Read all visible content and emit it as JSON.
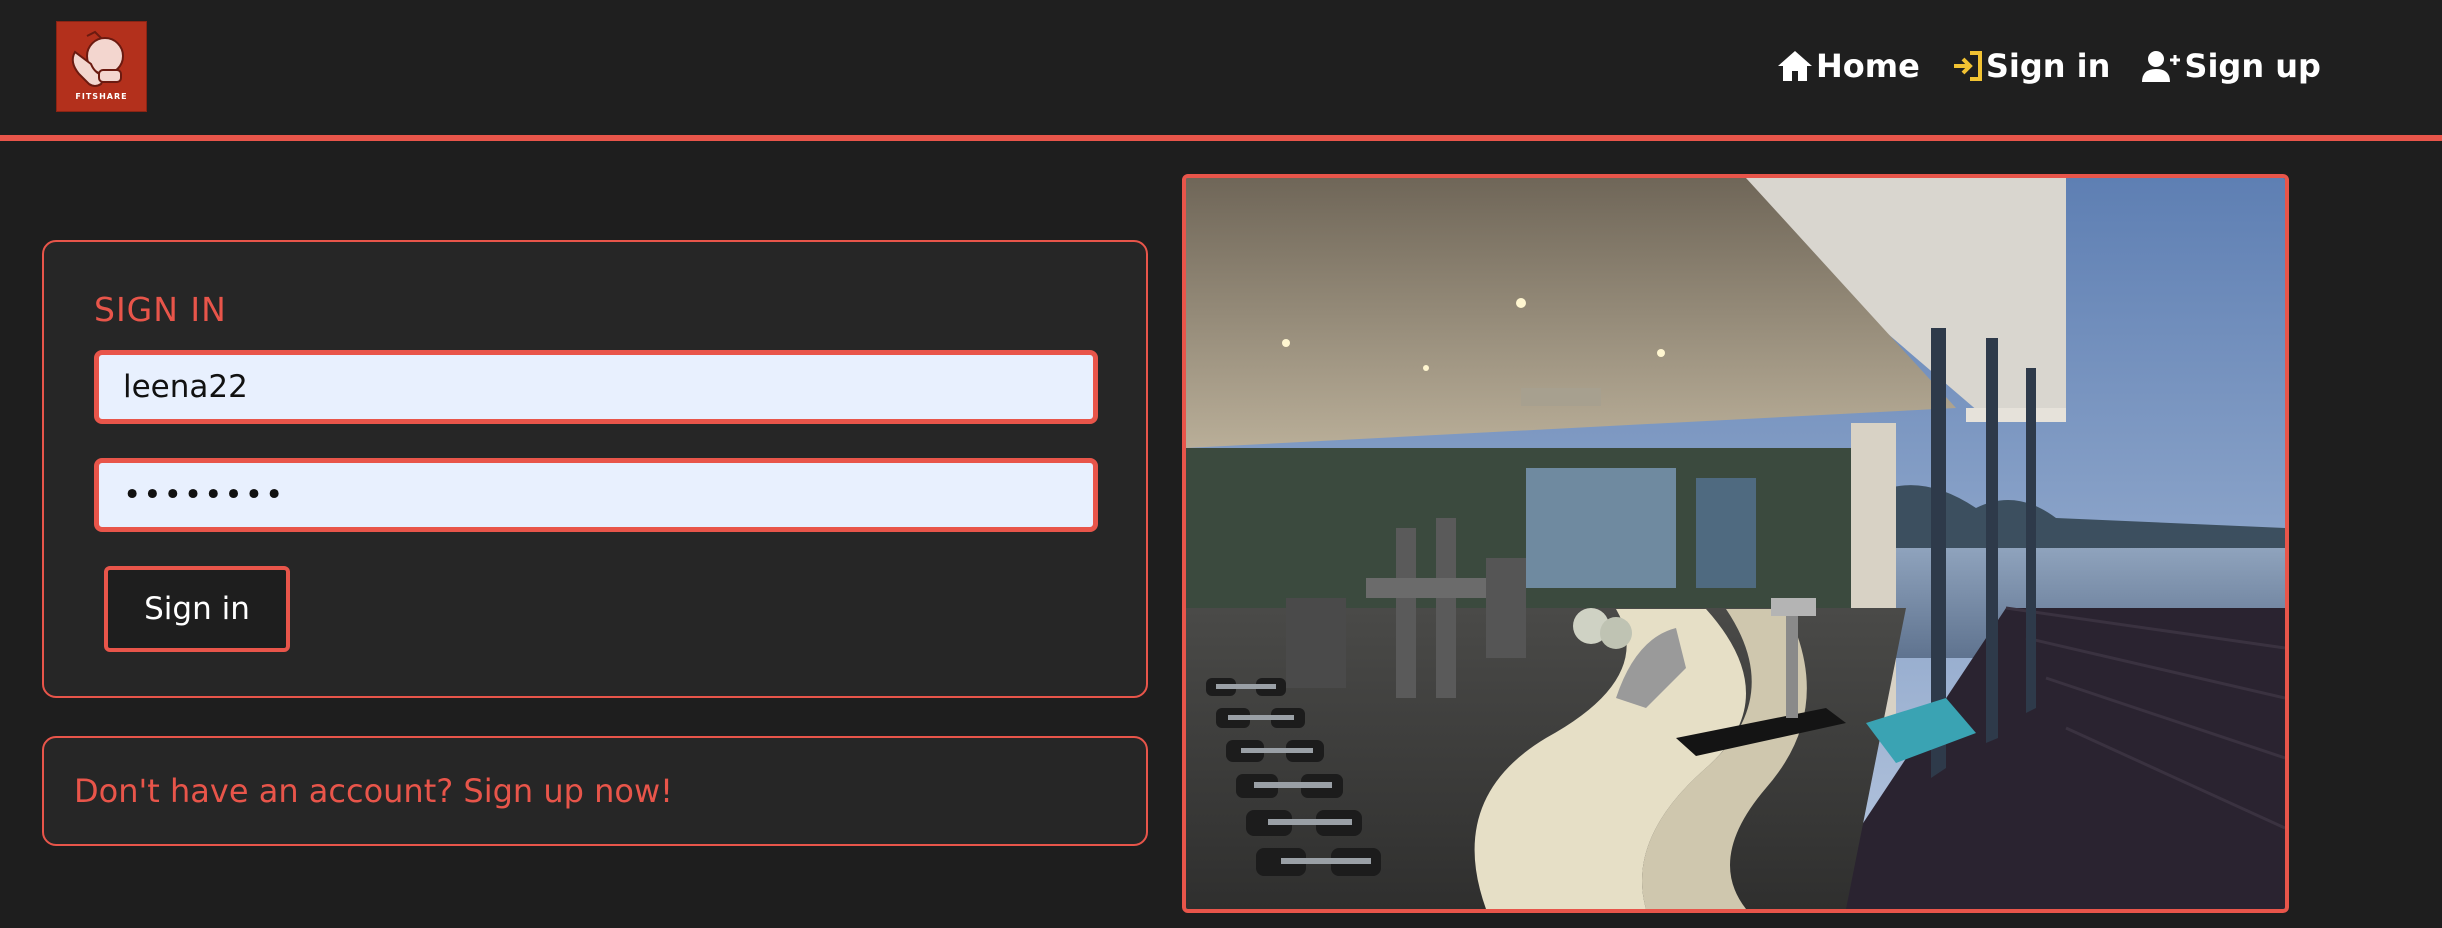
{
  "brand": {
    "logo_text": "FITSHARE"
  },
  "nav": {
    "home": "Home",
    "signin": "Sign in",
    "signup": "Sign up"
  },
  "signin_form": {
    "title": "SIGN IN",
    "username_value": "leena22",
    "password_value": "••••••••",
    "submit_label": "Sign in"
  },
  "signup_prompt": {
    "text": "Don't have an account? Sign up now!"
  },
  "colors": {
    "accent": "#e8554a",
    "background": "#1e1e1e",
    "card": "#262626",
    "input_bg": "#e8f0fe",
    "signin_icon": "#f1c232"
  },
  "icons": [
    "home-icon",
    "sign-in-icon",
    "user-plus-icon"
  ]
}
